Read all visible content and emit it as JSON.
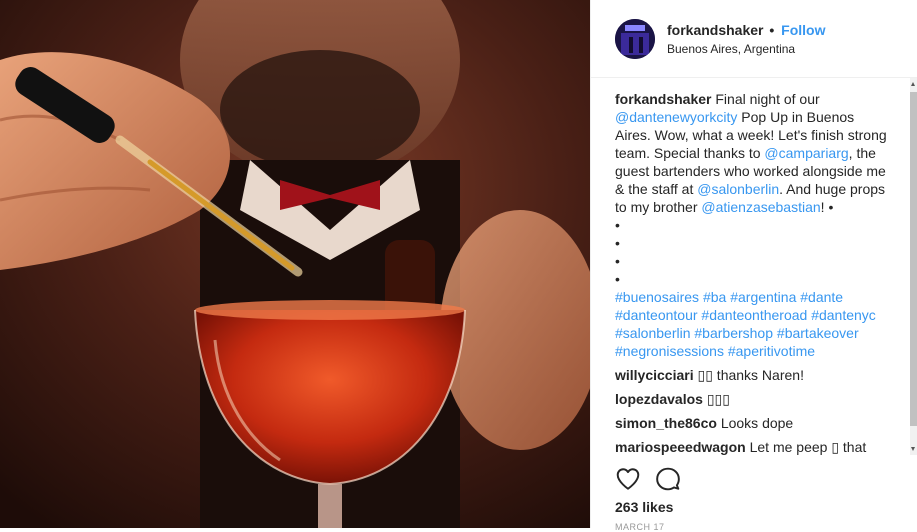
{
  "post": {
    "username": "forkandshaker",
    "separator": "•",
    "follow_label": "Follow",
    "location": "Buenos Aires, Argentina"
  },
  "caption": {
    "username": "forkandshaker",
    "t1": " Final night of our ",
    "m1": "@dantenewyorkcity",
    "t2": " Pop Up in Buenos Aires. Wow, what a week! Let's finish strong team. Special thanks to ",
    "m2": "@campariarg",
    "t3": ", the guest bartenders who worked alongside me & the staff at ",
    "m3": "@salonberlin",
    "t4": ". And huge props to my brother ",
    "m4": "@atienzasebastian",
    "t5": "! •",
    "bullets": [
      "•",
      "•",
      "•",
      "•"
    ],
    "hashtags": [
      "#buenosaires",
      "#ba",
      "#argentina",
      "#dante",
      "#danteontour",
      "#danteontheroad",
      "#dantenyc",
      "#salonberlin",
      "#barbershop",
      "#bartakeover",
      "#negronisessions",
      "#aperitivotime"
    ]
  },
  "comments": [
    {
      "user": "willycicciari",
      "text": "▯▯ thanks Naren!"
    },
    {
      "user": "lopezdavalos",
      "text": "▯▯▯"
    },
    {
      "user": "simon_the86co",
      "text": "Looks dope"
    },
    {
      "user": "mariospeeedwagon",
      "text": "Let me peep ▯ that"
    }
  ],
  "actions": {
    "like_icon": "heart-icon",
    "comment_icon": "comment-icon"
  },
  "likes_text": "263 likes",
  "date_text": "MARCH 17"
}
